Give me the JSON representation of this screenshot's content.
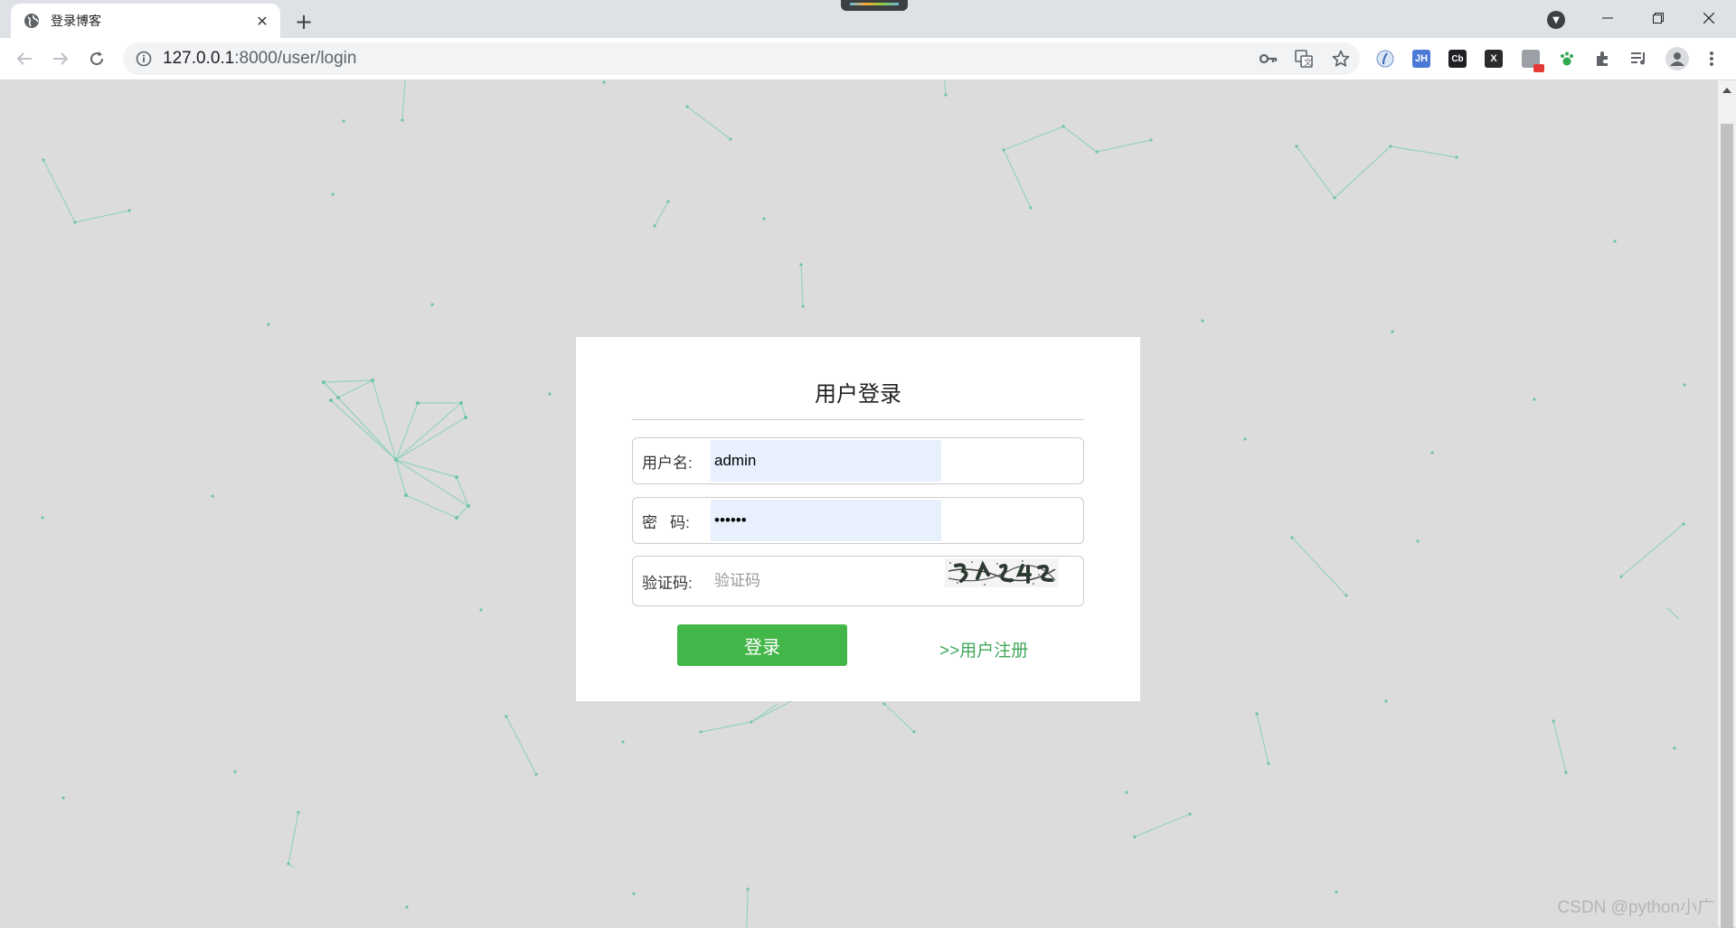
{
  "browser": {
    "tab_title": "登录博客",
    "url_host": "127.0.0.1",
    "url_path": ":8000/user/login",
    "extensions": [
      "JH",
      "Cb",
      "X"
    ],
    "colors": {
      "tabstrip": "#dee1e6",
      "toolbar": "#ffffff",
      "omnibox": "#f1f3f4"
    }
  },
  "login": {
    "title": "用户登录",
    "username_label": "用户名:",
    "username_value": "admin",
    "password_label": "密   码:",
    "password_value": "••••••",
    "captcha_label": "验证码:",
    "captcha_placeholder": "验证码",
    "submit_label": "登录",
    "register_label": ">>用户注册",
    "colors": {
      "button": "#43b649",
      "link": "#43a85a",
      "autofill": "#e8f0fe",
      "background": "#dcdcdc"
    }
  },
  "watermark": "CSDN @python小广"
}
